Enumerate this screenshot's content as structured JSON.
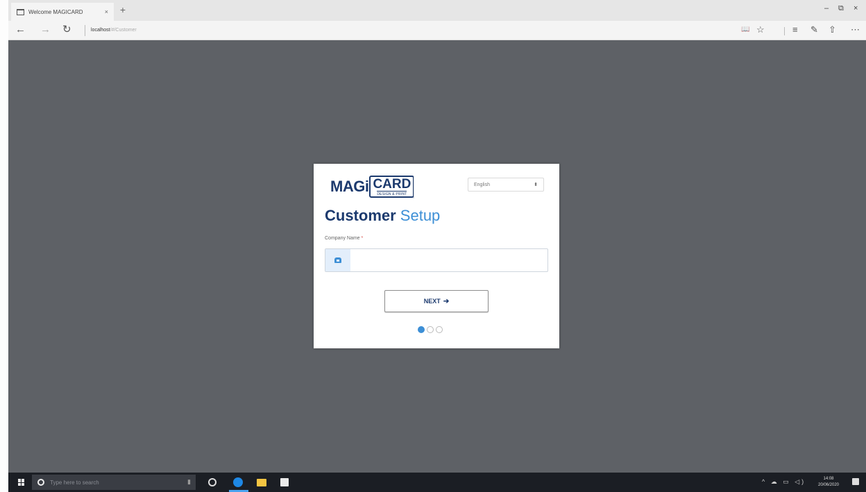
{
  "browser": {
    "tab_title": "Welcome MAGICARD",
    "tab_close": "×",
    "new_tab": "+",
    "url_host": "localhost",
    "url_path": "/#/Customer",
    "window_controls": [
      "–",
      "⧉",
      "×"
    ],
    "nav": {
      "back": "←",
      "forward": "→",
      "refresh": "↻"
    },
    "tools": {
      "reading_view": "📖",
      "favorite": "☆",
      "hub": "≡",
      "notes": "✎",
      "share": "⇧",
      "more": "⋯"
    }
  },
  "setup_card": {
    "logo": {
      "magi": "MAGi",
      "card": "CARD",
      "sub": "DESIGN & PRINT"
    },
    "language_selected": "English",
    "language_arrow": "⬍",
    "heading_bold": "Customer",
    "heading_light": " Setup",
    "company_label": "Company Name",
    "required_mark": "*",
    "company_value": "",
    "next_label": "NEXT",
    "next_arrow": "➔",
    "steps": [
      true,
      false,
      false
    ]
  },
  "taskbar": {
    "search_placeholder": "Type here to search",
    "mic": "▮",
    "tray": "^ ☁ ▭ ◁)",
    "time": "14:08",
    "date": "20/06/2020"
  },
  "colors": {
    "navy": "#1c3a6e",
    "accent_blue": "#3d8fd6",
    "page_background": "#5e6166"
  }
}
